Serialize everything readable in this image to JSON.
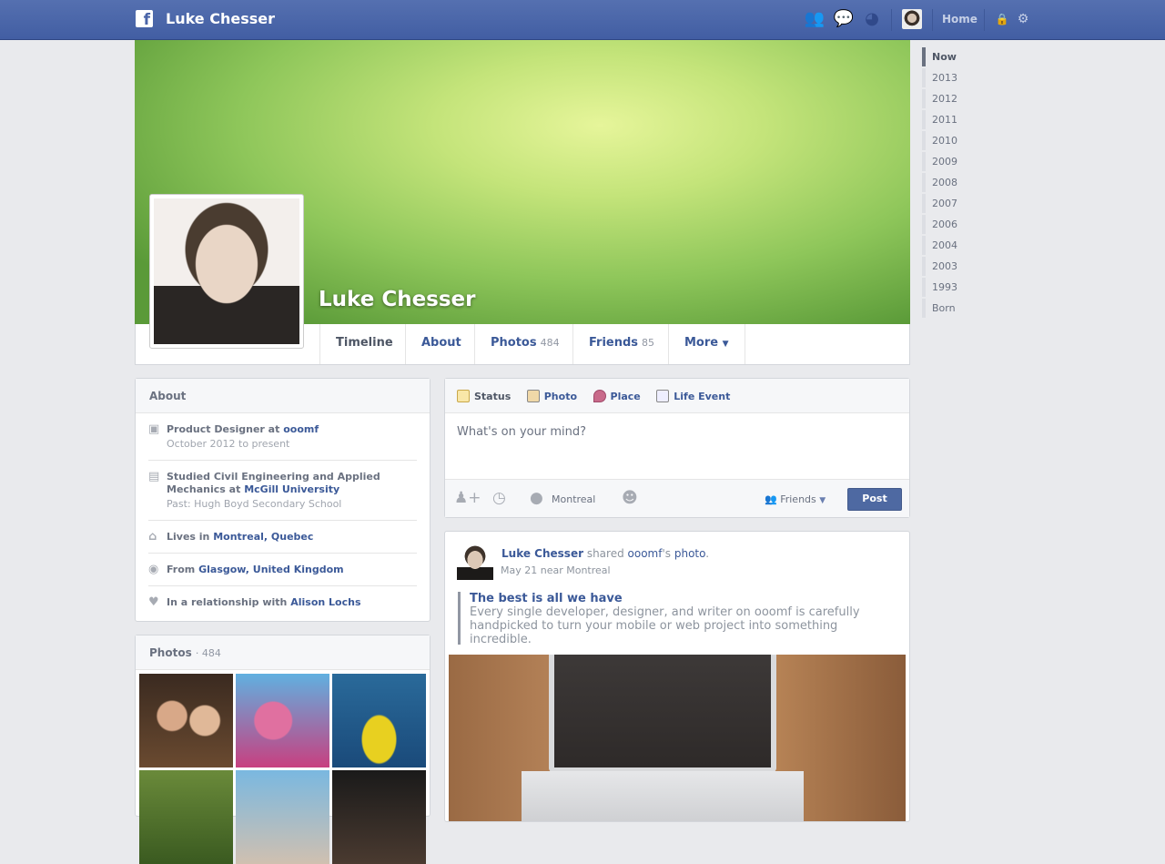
{
  "topbar": {
    "name": "Luke Chesser",
    "home": "Home",
    "icons": [
      "friends-icon",
      "messages-icon",
      "globe-icon",
      "privacy-icon",
      "gear-icon"
    ]
  },
  "profile": {
    "name": "Luke Chesser"
  },
  "tabs": [
    {
      "label": "Timeline"
    },
    {
      "label": "About"
    },
    {
      "label": "Photos",
      "count": "484"
    },
    {
      "label": "Friends",
      "count": "85"
    },
    {
      "label": "More"
    }
  ],
  "timeline": [
    "Now",
    "2013",
    "2012",
    "2011",
    "2010",
    "2009",
    "2008",
    "2007",
    "2006",
    "2004",
    "2003",
    "1993",
    "Born"
  ],
  "about": {
    "title": "About",
    "work": {
      "text": "Product Designer at ",
      "link": "ooomf",
      "sub": "October 2012 to present"
    },
    "edu": {
      "text": "Studied Civil Engineering and Applied Mechanics at ",
      "link": "McGill University",
      "sub": "Past: Hugh Boyd Secondary School"
    },
    "lives": {
      "text": "Lives in ",
      "link": "Montreal, Quebec"
    },
    "from": {
      "text": "From ",
      "link": "Glasgow, United Kingdom"
    },
    "rel": {
      "text": "In a relationship with ",
      "link": "Alison Lochs"
    }
  },
  "photos": {
    "title": "Photos",
    "count": "· 484"
  },
  "composer": {
    "tabs": [
      "Status",
      "Photo",
      "Place",
      "Life Event"
    ],
    "placeholder": "What's on your mind?",
    "location": "Montreal",
    "audience": "Friends",
    "post": "Post"
  },
  "post": {
    "author": "Luke Chesser",
    "shared": " shared ",
    "owner": "ooomf",
    "possessive": "'s ",
    "object": "photo",
    "period": ".",
    "meta": "May 21 near Montreal",
    "quote_title": "The best is all we have",
    "quote_text": "Every single developer, designer, and writer on ooomf is carefully handpicked to turn your mobile or web project into something incredible."
  }
}
